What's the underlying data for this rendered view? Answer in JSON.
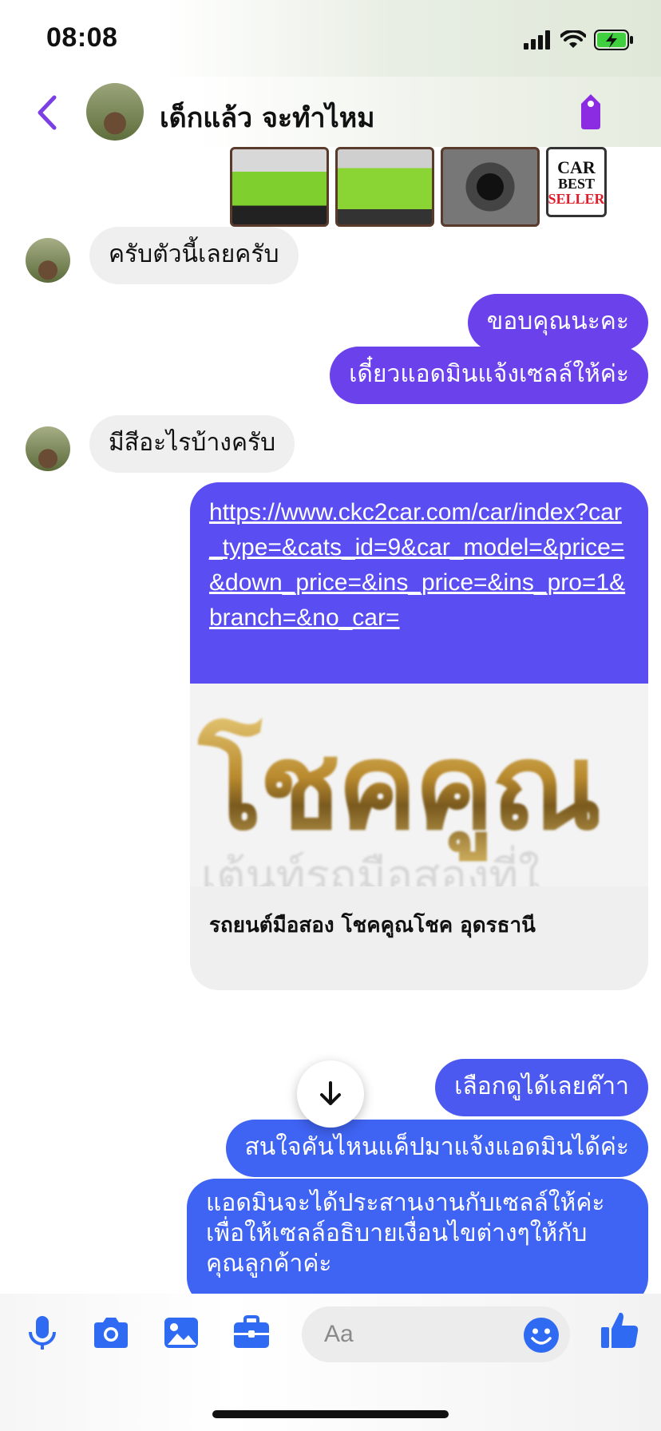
{
  "status_bar": {
    "time": "08:08"
  },
  "header": {
    "contact_name": "เด็กแล้ว จะทำไหม"
  },
  "car_badge": {
    "line1": "CAR",
    "line2": "BEST",
    "line3": "SELLER"
  },
  "messages": {
    "m1": "ครับตัวนี้เลยครับ",
    "m2": "ขอบคุณนะคะ",
    "m3": "เดี๋ยวแอดมินแจ้งเซลล์ให้ค่ะ",
    "m4": "มีสีอะไรบ้างครับ",
    "link_url": "https://www.ckc2car.com/car/index?car_type=&cats_id=9&car_model=&price=&down_price=&ins_price=&ins_pro=1&branch=&no_car=",
    "link_logo_text": "โชคคูณ",
    "link_logo_sub": "เต้นท์รถมือสองที่ใ",
    "link_title": "รถยนต์มือสอง โชคคูณโชค อุดรธานี",
    "m5": "เลือกดูได้เลยค๊าา",
    "m6": "สนใจคันไหนแค็ปมาแจ้งแอดมินได้ค่ะ",
    "m7_line1": "แอดมินจะได้ประสานงานกับเซลล์ให้ค่ะ",
    "m7_line2": "เพื่อให้เซลล์อธิบายเงื่อนไขต่างๆให้กับ",
    "m7_line3": "คุณลูกค้าค่ะ"
  },
  "composer": {
    "placeholder": "Aa"
  },
  "colors": {
    "accent": "#7b3fe4",
    "messenger_blue": "#3f63f2",
    "incoming_bg": "#efefef"
  },
  "icons": [
    "back-icon",
    "tag-icon",
    "mic-icon",
    "camera-icon",
    "image-icon",
    "briefcase-icon",
    "emoji-icon",
    "like-icon",
    "arrow-down-icon"
  ]
}
